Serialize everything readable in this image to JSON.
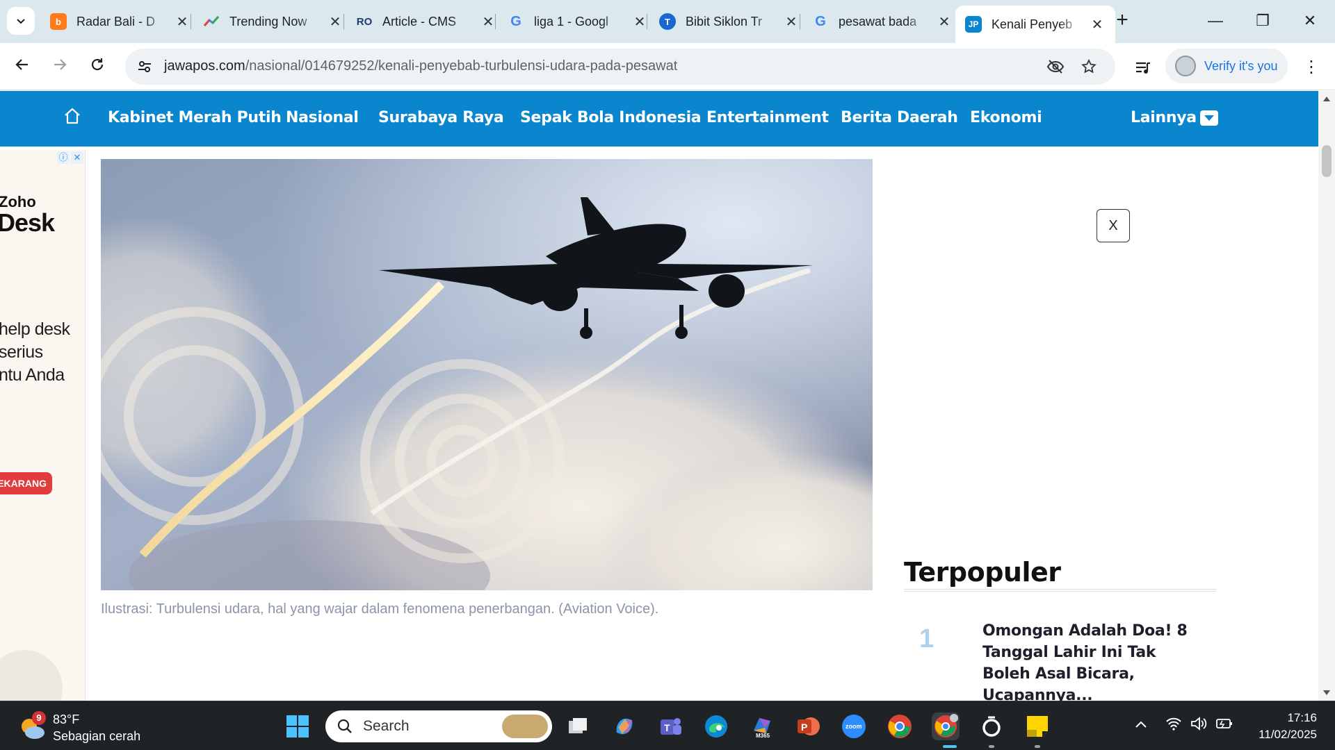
{
  "browser": {
    "tabs": [
      {
        "title": "Radar Bali - D",
        "favicon": "radar-bali-icon",
        "color": "#ff7a1a",
        "letter": "b"
      },
      {
        "title": "Trending Now",
        "favicon": "trending-icon",
        "color": "#ffffff",
        "letter": ""
      },
      {
        "title": "Article - CMS",
        "favicon": "cms-icon",
        "color": "#ffffff",
        "letter": "RO"
      },
      {
        "title": "liga 1 - Googl",
        "favicon": "google-icon",
        "color": "#ffffff",
        "letter": "G"
      },
      {
        "title": "Bibit Siklon Tr",
        "favicon": "bibit-icon",
        "color": "#1967d2",
        "letter": "T"
      },
      {
        "title": "pesawat bada",
        "favicon": "google-icon",
        "color": "#ffffff",
        "letter": "G"
      },
      {
        "title": "Kenali Penyeb",
        "favicon": "jawapos-icon",
        "color": "#0a86cf",
        "letter": "JP",
        "active": true
      }
    ],
    "url_domain": "jawapos.com",
    "url_path": "/nasional/014679252/kenali-penyebab-turbulensi-udara-pada-pesawat",
    "verify_label": "Verify it's you"
  },
  "site_nav": {
    "items": [
      "Kabinet Merah Putih",
      "Nasional",
      "Surabaya Raya",
      "Sepak Bola Indonesia",
      "Entertainment",
      "Berita Daerah",
      "Ekonomi"
    ],
    "more_label": "Lainnya",
    "accent": "#0a86cf"
  },
  "left_ad": {
    "brand_line1": "Zoho",
    "brand_line2": "Desk",
    "body_lines": [
      "help desk",
      "serius",
      "ntu Anda"
    ],
    "cta": "EKARANG"
  },
  "article": {
    "caption": "Ilustrasi: Turbulensi udara, hal yang wajar dalam fenomena penerbangan. (Aviation Voice)."
  },
  "sidebar": {
    "close_label": "X",
    "popular_title": "Terpopuler",
    "popular_items": [
      {
        "rank": "1",
        "title": "Omongan Adalah Doa! 8 Tanggal Lahir Ini Tak Boleh Asal Bicara, Ucapannya..."
      }
    ]
  },
  "taskbar": {
    "weather_temp": "83°F",
    "weather_desc": "Sebagian cerah",
    "weather_badge": "9",
    "search_placeholder": "Search",
    "time": "17:16",
    "date": "11/02/2025",
    "apps": [
      "windows-start-icon",
      "task-view-icon",
      "copilot-icon",
      "teams-icon",
      "edge-icon",
      "m365-icon",
      "powerpoint-icon",
      "zoom-icon",
      "chrome-icon",
      "chrome-profile-icon",
      "cortana-ring-icon",
      "sticky-notes-icon"
    ]
  }
}
